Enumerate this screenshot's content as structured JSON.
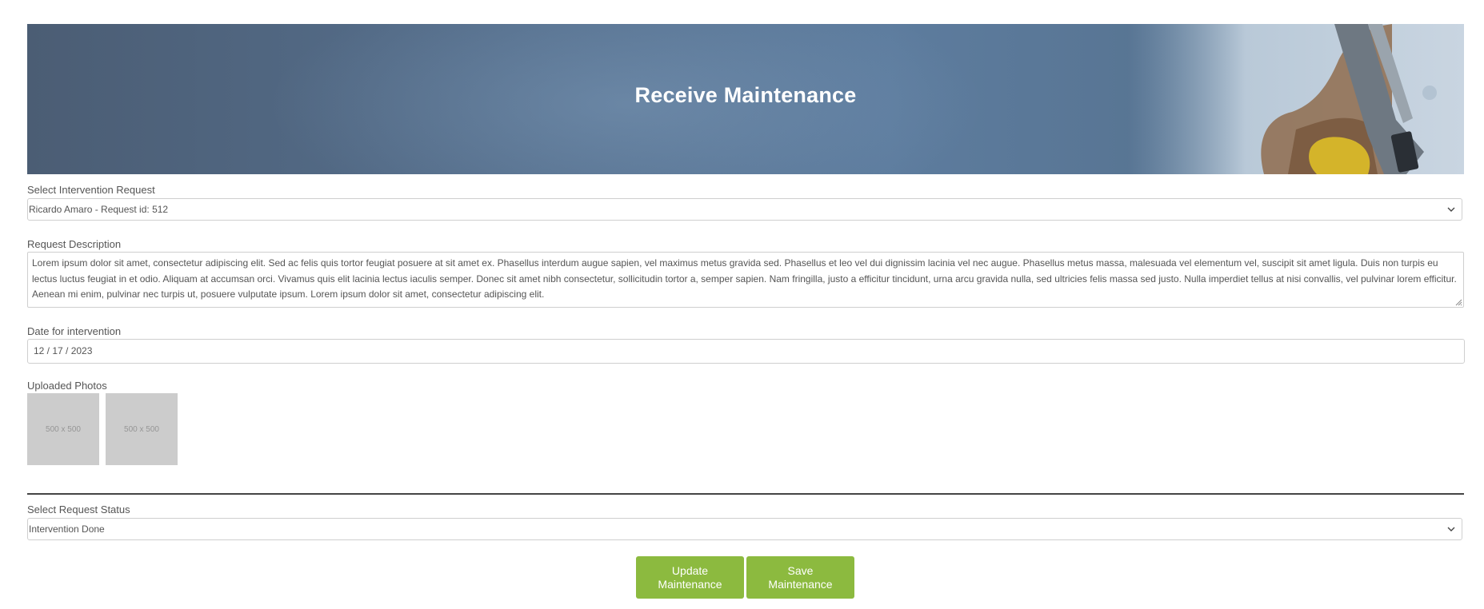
{
  "header": {
    "title": "Receive Maintenance"
  },
  "form": {
    "intervention_request": {
      "label": "Select Intervention Request",
      "value": "Ricardo Amaro - Request id: 512"
    },
    "description": {
      "label": "Request Description",
      "value": "Lorem ipsum dolor sit amet, consectetur adipiscing elit. Sed ac felis quis tortor feugiat posuere at sit amet ex. Phasellus interdum augue sapien, vel maximus metus gravida sed. Phasellus et leo vel dui dignissim lacinia vel nec augue. Phasellus metus massa, malesuada vel elementum vel, suscipit sit amet ligula. Duis non turpis eu lectus luctus feugiat in et odio. Aliquam at accumsan orci. Vivamus quis elit lacinia lectus iaculis semper. Donec sit amet nibh consectetur, sollicitudin tortor a, semper sapien. Nam fringilla, justo a efficitur tincidunt, urna arcu gravida nulla, sed ultricies felis massa sed justo. Nulla imperdiet tellus at nisi convallis, vel pulvinar lorem efficitur. Aenean mi enim, pulvinar nec turpis ut, posuere vulputate ipsum. Lorem ipsum dolor sit amet, consectetur adipiscing elit."
    },
    "date": {
      "label": "Date for intervention",
      "value": "12 / 17 / 2023"
    },
    "photos": {
      "label": "Uploaded Photos",
      "items": [
        {
          "placeholder": "500 x 500"
        },
        {
          "placeholder": "500 x 500"
        }
      ]
    },
    "status": {
      "label": "Select Request Status",
      "value": "Intervention Done"
    }
  },
  "actions": {
    "update_label": "Update Maintenance",
    "save_label": "Save Maintenance"
  },
  "colors": {
    "accent": "#8cba3f",
    "hero_base": "#56708e",
    "text": "#555555",
    "border": "#cfcfcf"
  },
  "icons": {
    "select_arrow": "chevron-down-icon",
    "textarea_resize": "resize-grip-icon"
  }
}
